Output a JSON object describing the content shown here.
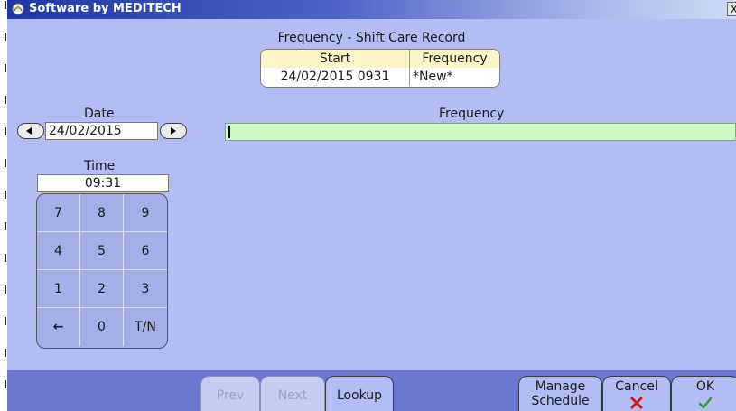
{
  "window": {
    "title": "Software by MEDITECH",
    "close_label": "X"
  },
  "record": {
    "title": "Frequency - Shift Care Record",
    "columns": [
      "Start",
      "Frequency"
    ],
    "rows": [
      {
        "start": "24/02/2015  0931",
        "frequency": "*New*"
      }
    ]
  },
  "date": {
    "label": "Date",
    "value": "24/02/2015"
  },
  "frequency": {
    "label": "Frequency",
    "value": ""
  },
  "time": {
    "label": "Time",
    "value": "09:31"
  },
  "keypad": {
    "keys": [
      "7",
      "8",
      "9",
      "4",
      "5",
      "6",
      "1",
      "2",
      "3",
      "←",
      "0",
      "T/N"
    ]
  },
  "footer": {
    "prev_label": "Prev",
    "next_label": "Next",
    "lookup_label": "Lookup",
    "manage_label_line1": "Manage",
    "manage_label_line2": "Schedule",
    "cancel_label": "Cancel",
    "ok_label": "OK"
  },
  "colors": {
    "background": "#b3bcf3",
    "titlebar": "#1f37a6",
    "footer": "#6a79cf",
    "input_active": "#ccfcc3",
    "table_header": "#fdf5c7",
    "cancel_icon": "#d01818",
    "ok_icon": "#2fa02f"
  }
}
